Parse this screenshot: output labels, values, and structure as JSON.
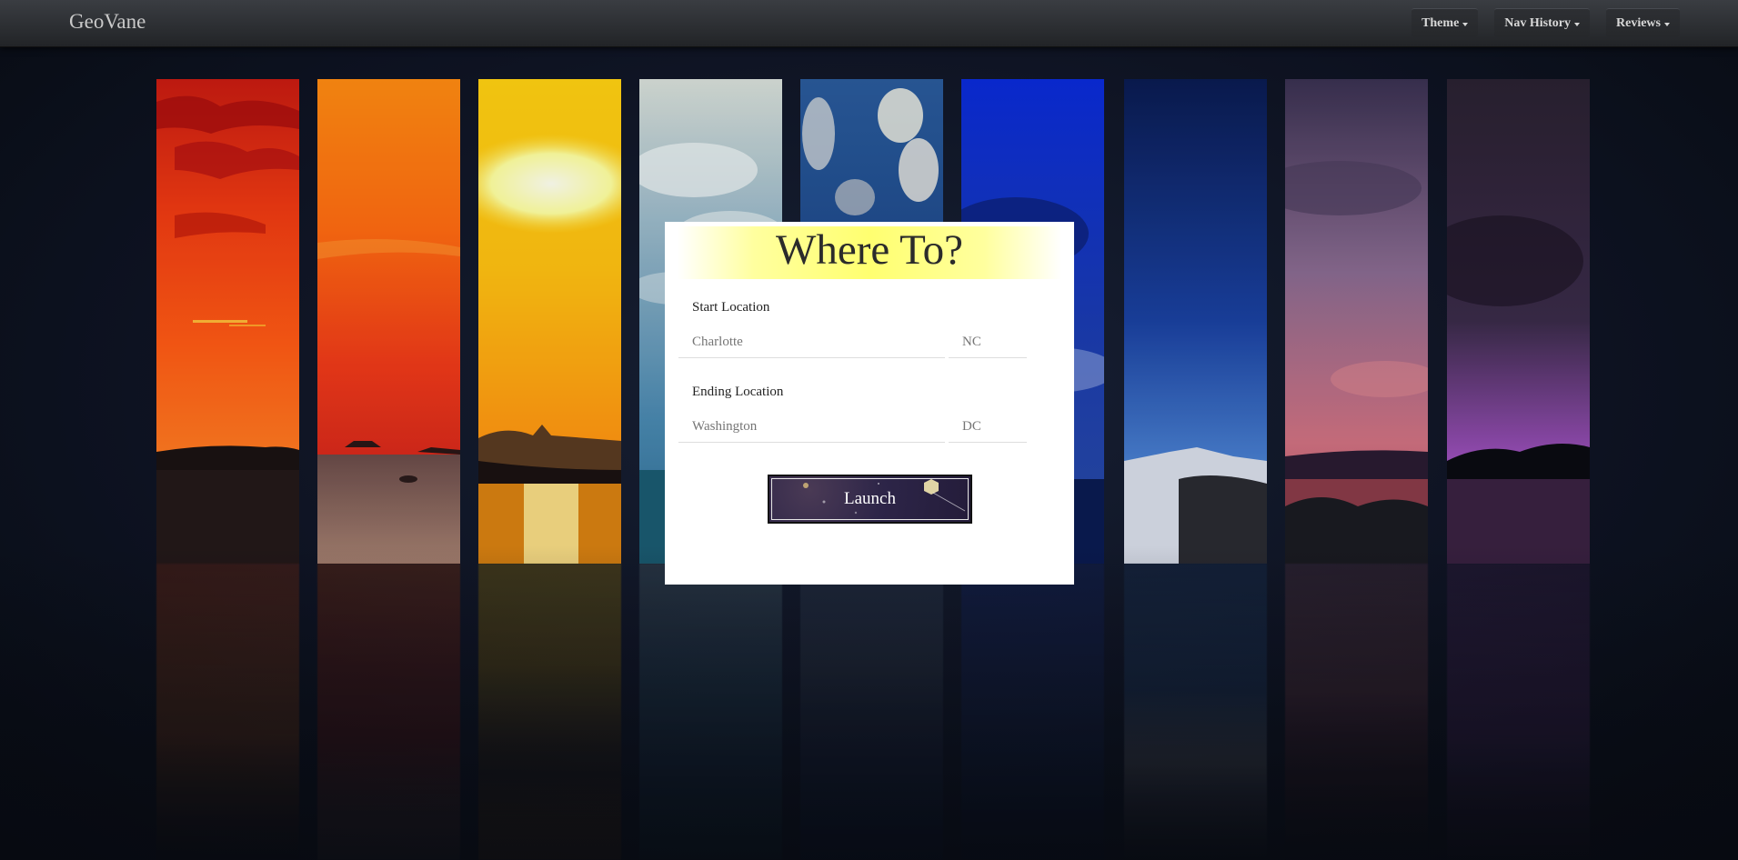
{
  "navbar": {
    "brand": "GeoVane",
    "items": [
      {
        "label": "Theme"
      },
      {
        "label": "Nav History"
      },
      {
        "label": "Reviews"
      }
    ]
  },
  "card": {
    "title": "Where To?",
    "start": {
      "label": "Start Location",
      "city_placeholder": "Charlotte",
      "state_placeholder": "NC"
    },
    "end": {
      "label": "Ending Location",
      "city_placeholder": "Washington",
      "state_placeholder": "DC"
    },
    "launch_label": "Launch"
  },
  "colors": {
    "navbar": "#2b2d31",
    "title_highlight": "#ffff70",
    "launch_bg": "#2d2548"
  }
}
